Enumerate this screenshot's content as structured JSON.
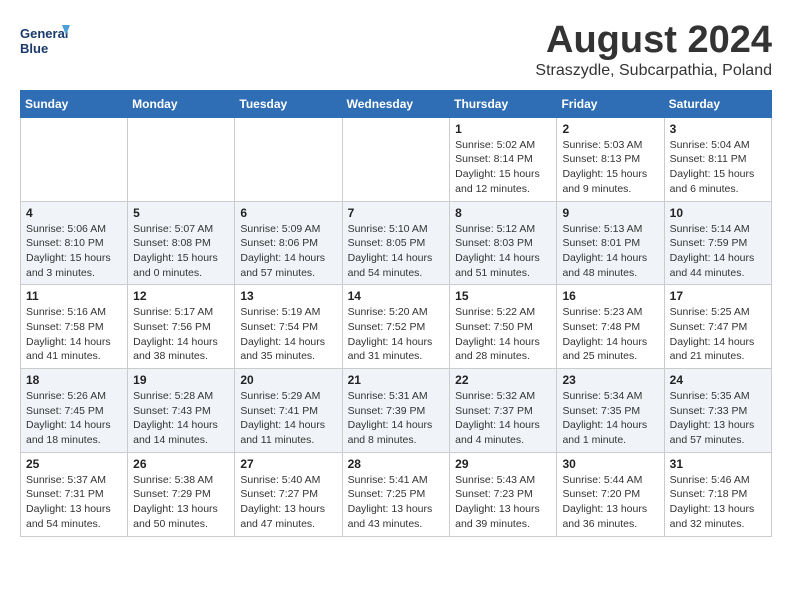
{
  "header": {
    "logo_line1": "General",
    "logo_line2": "Blue",
    "month_title": "August 2024",
    "location": "Straszydle, Subcarpathia, Poland"
  },
  "weekdays": [
    "Sunday",
    "Monday",
    "Tuesday",
    "Wednesday",
    "Thursday",
    "Friday",
    "Saturday"
  ],
  "weeks": [
    [
      {
        "day": "",
        "info": ""
      },
      {
        "day": "",
        "info": ""
      },
      {
        "day": "",
        "info": ""
      },
      {
        "day": "",
        "info": ""
      },
      {
        "day": "1",
        "info": "Sunrise: 5:02 AM\nSunset: 8:14 PM\nDaylight: 15 hours\nand 12 minutes."
      },
      {
        "day": "2",
        "info": "Sunrise: 5:03 AM\nSunset: 8:13 PM\nDaylight: 15 hours\nand 9 minutes."
      },
      {
        "day": "3",
        "info": "Sunrise: 5:04 AM\nSunset: 8:11 PM\nDaylight: 15 hours\nand 6 minutes."
      }
    ],
    [
      {
        "day": "4",
        "info": "Sunrise: 5:06 AM\nSunset: 8:10 PM\nDaylight: 15 hours\nand 3 minutes."
      },
      {
        "day": "5",
        "info": "Sunrise: 5:07 AM\nSunset: 8:08 PM\nDaylight: 15 hours\nand 0 minutes."
      },
      {
        "day": "6",
        "info": "Sunrise: 5:09 AM\nSunset: 8:06 PM\nDaylight: 14 hours\nand 57 minutes."
      },
      {
        "day": "7",
        "info": "Sunrise: 5:10 AM\nSunset: 8:05 PM\nDaylight: 14 hours\nand 54 minutes."
      },
      {
        "day": "8",
        "info": "Sunrise: 5:12 AM\nSunset: 8:03 PM\nDaylight: 14 hours\nand 51 minutes."
      },
      {
        "day": "9",
        "info": "Sunrise: 5:13 AM\nSunset: 8:01 PM\nDaylight: 14 hours\nand 48 minutes."
      },
      {
        "day": "10",
        "info": "Sunrise: 5:14 AM\nSunset: 7:59 PM\nDaylight: 14 hours\nand 44 minutes."
      }
    ],
    [
      {
        "day": "11",
        "info": "Sunrise: 5:16 AM\nSunset: 7:58 PM\nDaylight: 14 hours\nand 41 minutes."
      },
      {
        "day": "12",
        "info": "Sunrise: 5:17 AM\nSunset: 7:56 PM\nDaylight: 14 hours\nand 38 minutes."
      },
      {
        "day": "13",
        "info": "Sunrise: 5:19 AM\nSunset: 7:54 PM\nDaylight: 14 hours\nand 35 minutes."
      },
      {
        "day": "14",
        "info": "Sunrise: 5:20 AM\nSunset: 7:52 PM\nDaylight: 14 hours\nand 31 minutes."
      },
      {
        "day": "15",
        "info": "Sunrise: 5:22 AM\nSunset: 7:50 PM\nDaylight: 14 hours\nand 28 minutes."
      },
      {
        "day": "16",
        "info": "Sunrise: 5:23 AM\nSunset: 7:48 PM\nDaylight: 14 hours\nand 25 minutes."
      },
      {
        "day": "17",
        "info": "Sunrise: 5:25 AM\nSunset: 7:47 PM\nDaylight: 14 hours\nand 21 minutes."
      }
    ],
    [
      {
        "day": "18",
        "info": "Sunrise: 5:26 AM\nSunset: 7:45 PM\nDaylight: 14 hours\nand 18 minutes."
      },
      {
        "day": "19",
        "info": "Sunrise: 5:28 AM\nSunset: 7:43 PM\nDaylight: 14 hours\nand 14 minutes."
      },
      {
        "day": "20",
        "info": "Sunrise: 5:29 AM\nSunset: 7:41 PM\nDaylight: 14 hours\nand 11 minutes."
      },
      {
        "day": "21",
        "info": "Sunrise: 5:31 AM\nSunset: 7:39 PM\nDaylight: 14 hours\nand 8 minutes."
      },
      {
        "day": "22",
        "info": "Sunrise: 5:32 AM\nSunset: 7:37 PM\nDaylight: 14 hours\nand 4 minutes."
      },
      {
        "day": "23",
        "info": "Sunrise: 5:34 AM\nSunset: 7:35 PM\nDaylight: 14 hours\nand 1 minute."
      },
      {
        "day": "24",
        "info": "Sunrise: 5:35 AM\nSunset: 7:33 PM\nDaylight: 13 hours\nand 57 minutes."
      }
    ],
    [
      {
        "day": "25",
        "info": "Sunrise: 5:37 AM\nSunset: 7:31 PM\nDaylight: 13 hours\nand 54 minutes."
      },
      {
        "day": "26",
        "info": "Sunrise: 5:38 AM\nSunset: 7:29 PM\nDaylight: 13 hours\nand 50 minutes."
      },
      {
        "day": "27",
        "info": "Sunrise: 5:40 AM\nSunset: 7:27 PM\nDaylight: 13 hours\nand 47 minutes."
      },
      {
        "day": "28",
        "info": "Sunrise: 5:41 AM\nSunset: 7:25 PM\nDaylight: 13 hours\nand 43 minutes."
      },
      {
        "day": "29",
        "info": "Sunrise: 5:43 AM\nSunset: 7:23 PM\nDaylight: 13 hours\nand 39 minutes."
      },
      {
        "day": "30",
        "info": "Sunrise: 5:44 AM\nSunset: 7:20 PM\nDaylight: 13 hours\nand 36 minutes."
      },
      {
        "day": "31",
        "info": "Sunrise: 5:46 AM\nSunset: 7:18 PM\nDaylight: 13 hours\nand 32 minutes."
      }
    ]
  ]
}
